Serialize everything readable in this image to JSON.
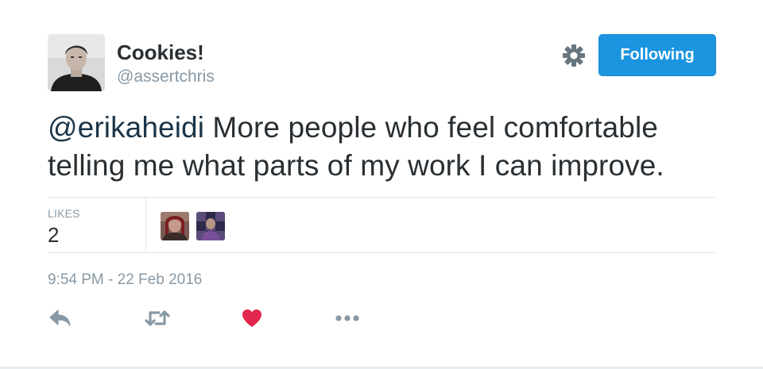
{
  "author": {
    "display_name": "Cookies!",
    "username": "@assertchris"
  },
  "header": {
    "settings_icon": "gear-icon",
    "follow_label": "Following"
  },
  "tweet": {
    "mention": "@erikaheidi",
    "text": " More people who feel comfortable telling me what parts of my work I can improve."
  },
  "stats": {
    "likes_label": "LIKES",
    "likes_count": "2"
  },
  "timestamp": "9:54 PM - 22 Feb 2016",
  "actions": [
    {
      "name": "reply",
      "icon": "reply-icon"
    },
    {
      "name": "retweet",
      "icon": "retweet-icon"
    },
    {
      "name": "like",
      "icon": "heart-icon",
      "active": true
    },
    {
      "name": "more",
      "icon": "more-icon"
    }
  ],
  "colors": {
    "accent": "#1b95e0",
    "like_active": "#e2264d",
    "icon_muted": "#8899a6",
    "text": "#292f33",
    "secondary_text": "#8899a6"
  }
}
